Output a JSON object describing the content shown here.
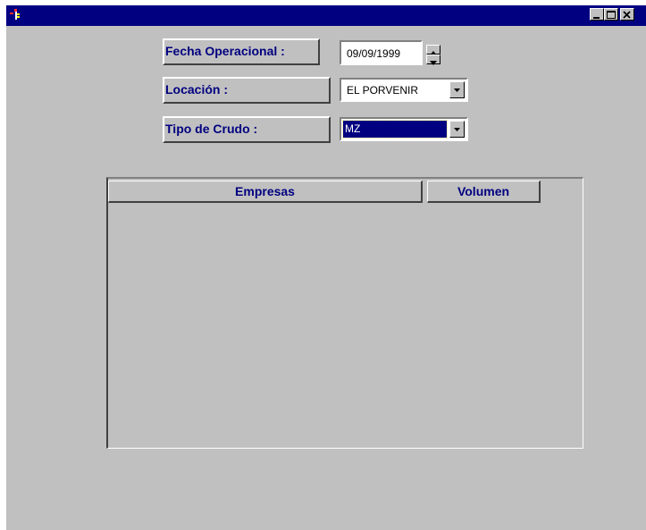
{
  "window": {
    "title": "",
    "controls": {
      "minimize": "_",
      "maximize": "□",
      "close": "×"
    }
  },
  "form": {
    "fecha": {
      "label": "Fecha Operacional :",
      "value": "09/09/1999"
    },
    "locacion": {
      "label": "Locación :",
      "value": "EL PORVENIR"
    },
    "tipo": {
      "label": "Tipo de Crudo :",
      "value": "MZ"
    }
  },
  "grid": {
    "columns": [
      "Empresas",
      "Volumen"
    ],
    "rows": []
  },
  "colors": {
    "titlebar": "#000080",
    "face": "#c0c0c0",
    "label_text": "#000080",
    "selection": "#000080"
  }
}
